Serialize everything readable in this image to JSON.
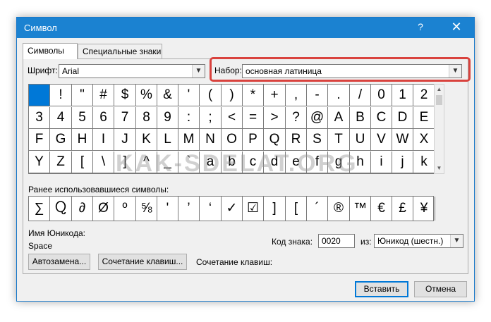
{
  "dialog": {
    "title": "Символ",
    "help_glyph": "?",
    "close_glyph": "✕"
  },
  "tabs": [
    {
      "label": "Символы",
      "active": true
    },
    {
      "label": "Специальные знаки",
      "active": false
    }
  ],
  "font": {
    "label": "Шрифт:",
    "value": "Arial"
  },
  "subset": {
    "label": "Набор:",
    "value": "основная латиница"
  },
  "symbols": [
    [
      " ",
      "!",
      "\"",
      "#",
      "$",
      "%",
      "&",
      "'",
      "(",
      ")",
      "*",
      "+",
      ",",
      "-",
      ".",
      "/",
      "0",
      "1",
      "2"
    ],
    [
      "3",
      "4",
      "5",
      "6",
      "7",
      "8",
      "9",
      ":",
      ";",
      "<",
      "=",
      ">",
      "?",
      "@",
      "A",
      "B",
      "C",
      "D",
      "E"
    ],
    [
      "F",
      "G",
      "H",
      "I",
      "J",
      "K",
      "L",
      "M",
      "N",
      "O",
      "P",
      "Q",
      "R",
      "S",
      "T",
      "U",
      "V",
      "W",
      "X"
    ],
    [
      "Y",
      "Z",
      "[",
      "\\",
      "]",
      "^",
      "_",
      "`",
      "a",
      "b",
      "c",
      "d",
      "e",
      "f",
      "g",
      "h",
      "i",
      "j",
      "k"
    ]
  ],
  "selected_symbol": {
    "row": 0,
    "col": 0
  },
  "recent": {
    "label": "Ранее использовавшиеся символы:",
    "items": [
      "∑",
      "Ⴍ",
      "∂",
      "Ø",
      "º",
      "⅝",
      "'",
      "’",
      "‘",
      "✓",
      "☑",
      "]",
      "[",
      "´",
      "®",
      "™",
      "€",
      "£",
      "¥"
    ]
  },
  "unicode_name": {
    "label": "Имя Юникода:",
    "value": "Space"
  },
  "char_code": {
    "label": "Код знака:",
    "value": "0020"
  },
  "from": {
    "label": "из:",
    "value": "Юникод (шестн.)"
  },
  "buttons": {
    "autocorrect": "Автозамена...",
    "shortcut_key": "Сочетание клавиш...",
    "shortcut_label": "Сочетание клавиш:",
    "insert": "Вставить",
    "cancel": "Отмена"
  },
  "watermark": "KAK-SDELAT.ORG",
  "colors": {
    "titlebar": "#1b82d1",
    "selection": "#0078d7",
    "highlight": "#d9423d"
  }
}
